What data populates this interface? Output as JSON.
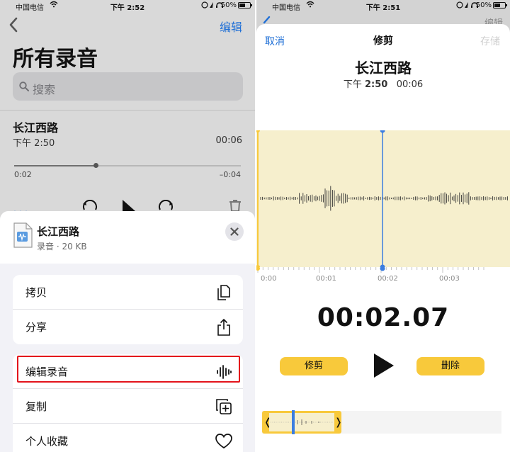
{
  "left": {
    "status": {
      "carrier": "中国电信",
      "time": "下午 2:52",
      "battery": "50%"
    },
    "header": {
      "edit": "编辑",
      "title": "所有录音"
    },
    "search": {
      "placeholder": "搜索"
    },
    "recording": {
      "name": "长江西路",
      "date": "下午 2:50",
      "duration": "00:06",
      "elapsed": "0:02",
      "remaining": "–0:04",
      "progress": 0.36
    },
    "sheet": {
      "file_name": "长江西路",
      "file_meta": "录音 · 20 KB",
      "group1": [
        {
          "label": "拷贝",
          "icon": "copy-icon"
        },
        {
          "label": "分享",
          "icon": "share-icon"
        }
      ],
      "group2": [
        {
          "label": "编辑录音",
          "icon": "waveform-icon"
        },
        {
          "label": "复制",
          "icon": "duplicate-icon"
        },
        {
          "label": "个人收藏",
          "icon": "heart-icon"
        }
      ]
    }
  },
  "right": {
    "status": {
      "carrier": "中国电信",
      "time": "下午 2:51",
      "battery": "50%"
    },
    "bg_edit": "编辑",
    "modal": {
      "cancel": "取消",
      "title": "修剪",
      "save": "存储",
      "rec_name": "长江西路",
      "rec_date_prefix": "下午",
      "rec_date_time": "2:50",
      "rec_duration": "00:06"
    },
    "ruler_labels": [
      "0:00",
      "00:01",
      "00:02",
      "00:03"
    ],
    "playhead_seconds": 2.07,
    "timer": "00:02.07",
    "trim_button": "修剪",
    "delete_button": "删除"
  },
  "colors": {
    "accent_blue": "#1f6fd6",
    "trim_yellow": "#f8c93b",
    "wave_bg": "#f6efcd",
    "playhead_blue": "#3b7de0",
    "highlight_red": "#e3141c"
  }
}
